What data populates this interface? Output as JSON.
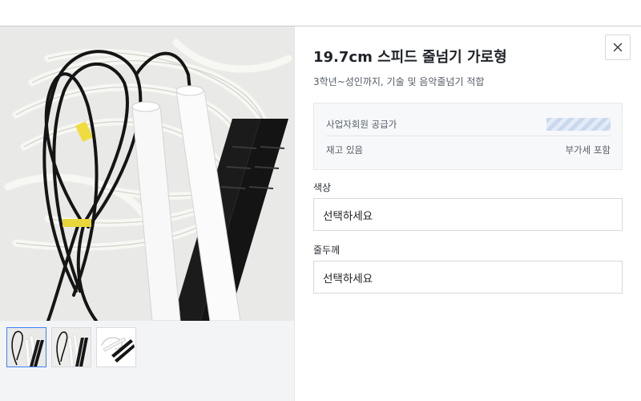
{
  "product": {
    "title": "19.7cm 스피드 줄넘기 가로형",
    "subtitle": "3학년~성인까지, 기술 및 음악줄넘기 적합"
  },
  "price_box": {
    "member_price_label": "사업자회원 공급가",
    "stock_label": "재고 있음",
    "vat_label": "부가세 포함"
  },
  "options": [
    {
      "label": "색상",
      "placeholder": "선택하세요"
    },
    {
      "label": "줄두께",
      "placeholder": "선택하세요"
    }
  ],
  "icons": {
    "close": "close-icon"
  },
  "colors": {
    "active_thumb_border": "#3b82f6",
    "price_placeholder": "#c9d8ee"
  }
}
